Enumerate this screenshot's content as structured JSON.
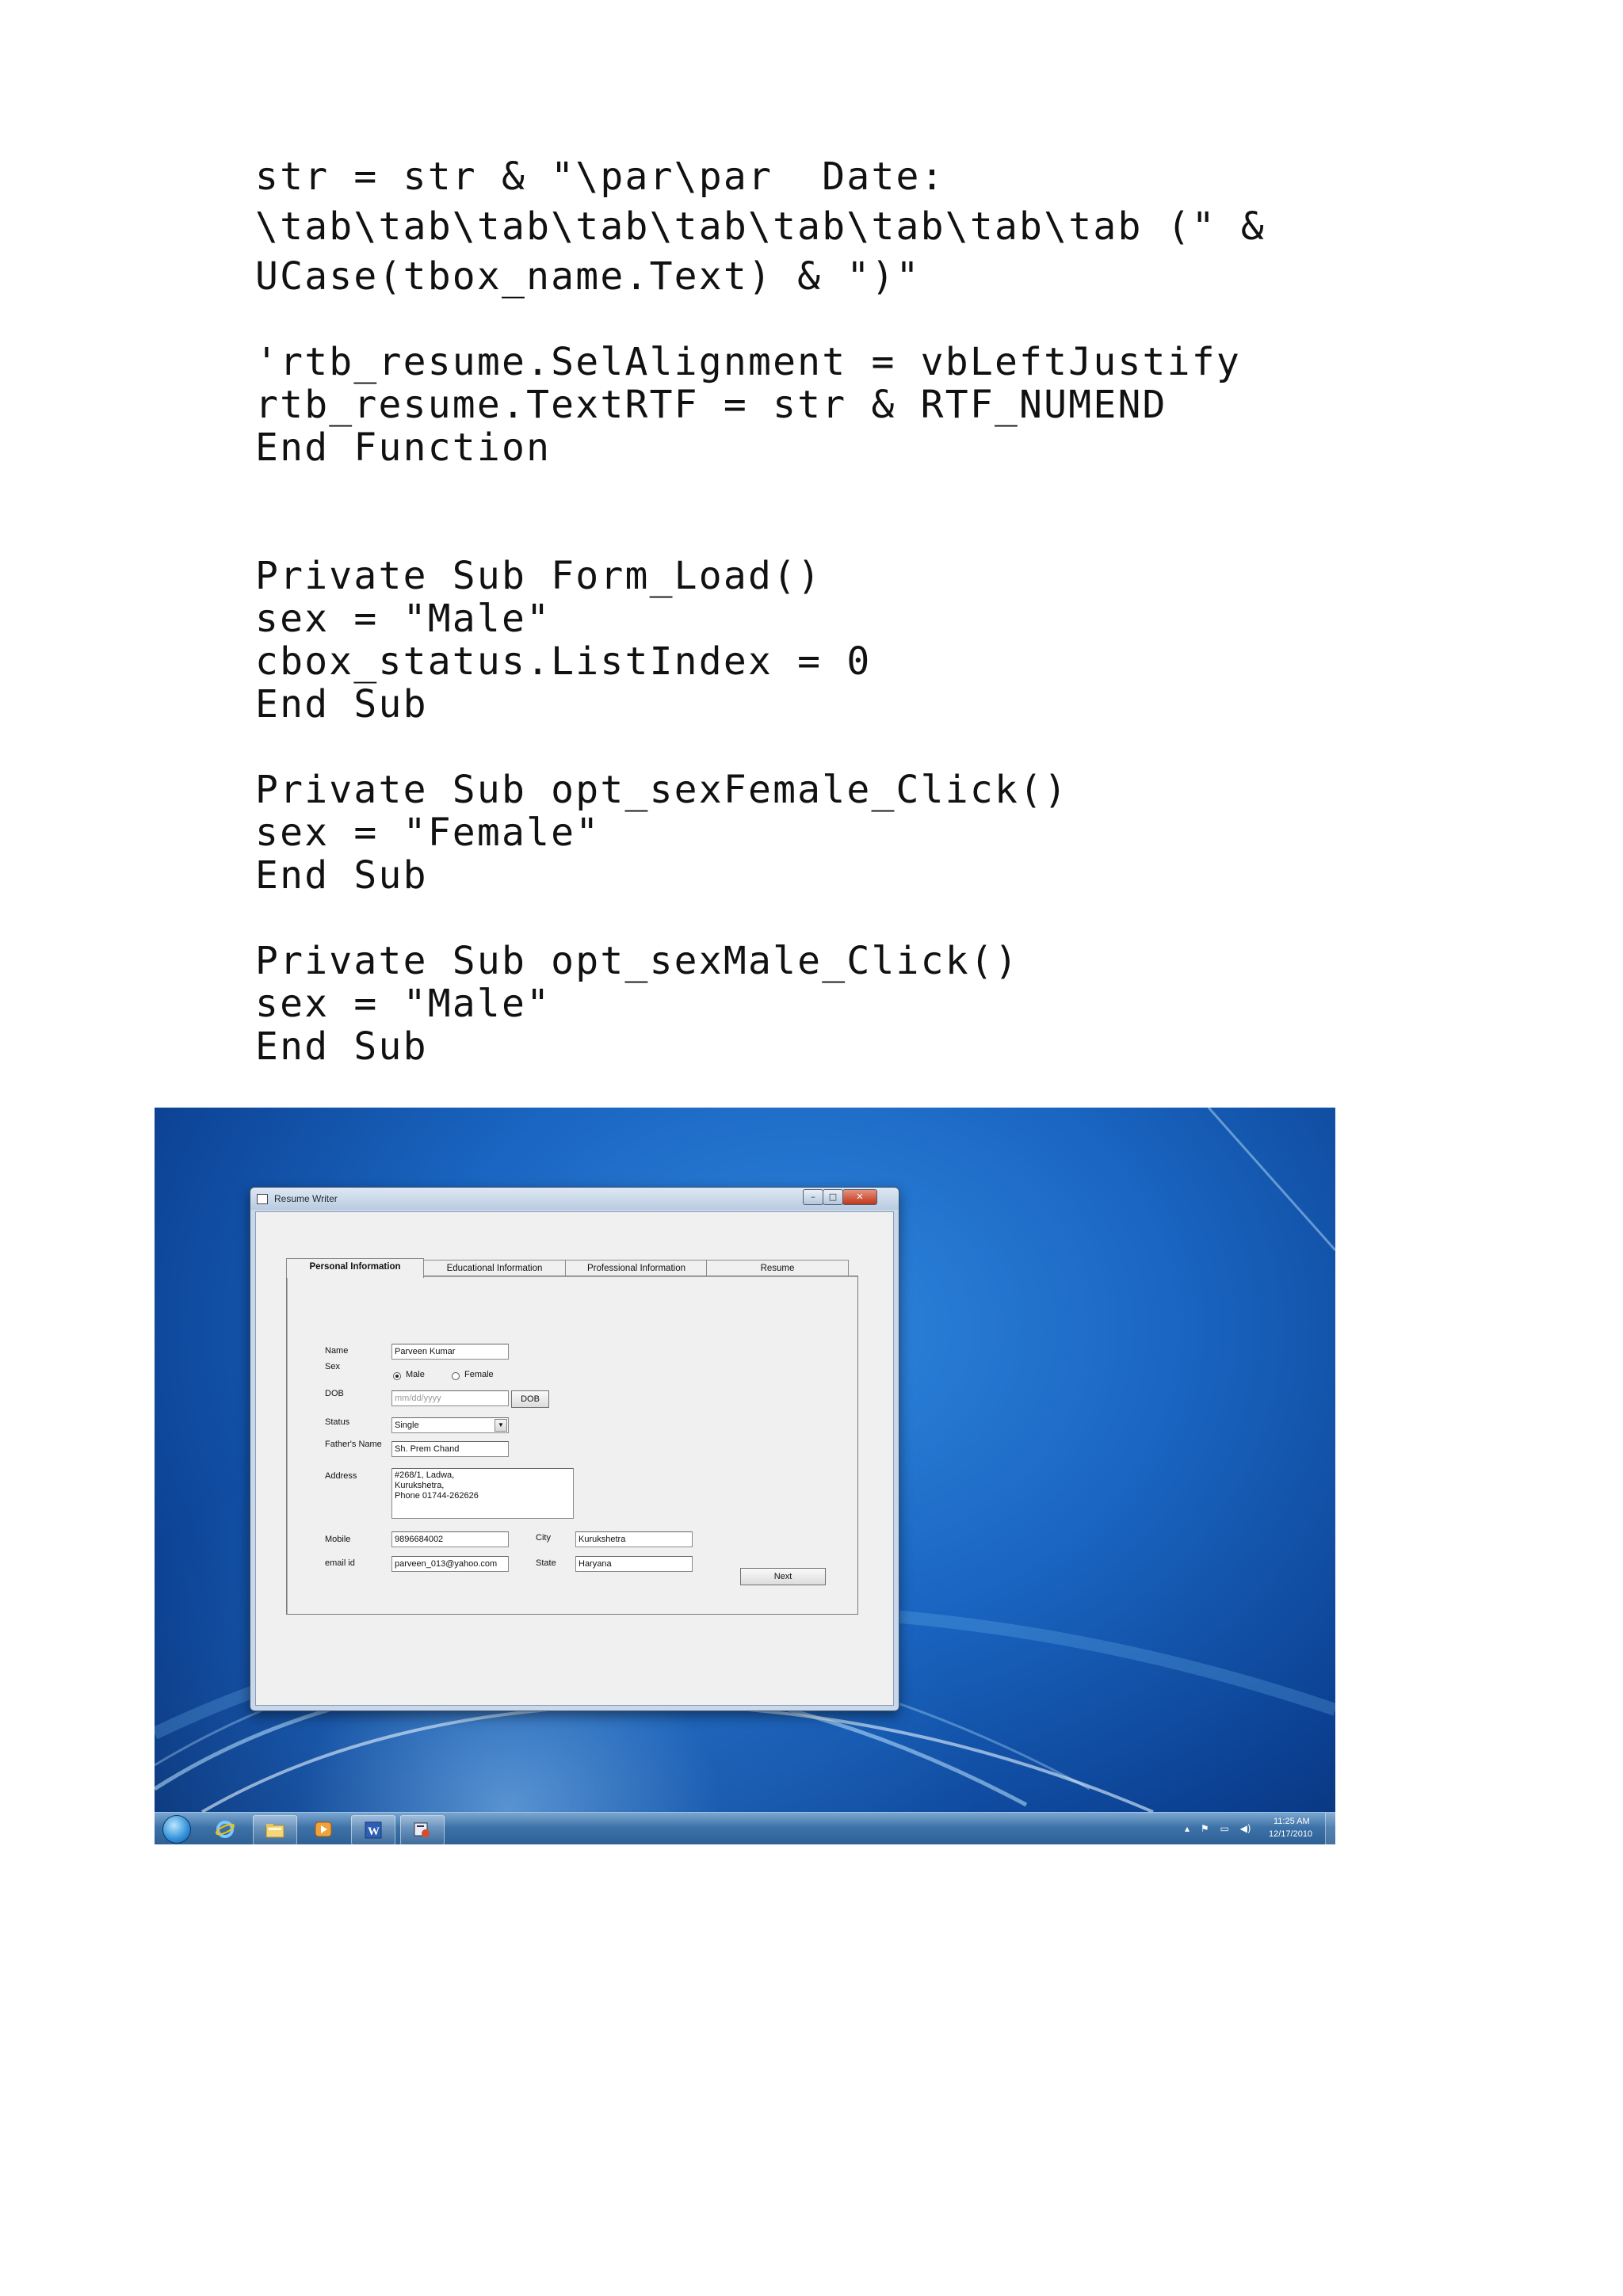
{
  "code_block_1": [
    "str = str & \"\\par\\par  Date:",
    "\\tab\\tab\\tab\\tab\\tab\\tab\\tab\\tab\\tab (\" &",
    "UCase(tbox_name.Text) & \")\""
  ],
  "code_block_2": [
    "'rtb_resume.SelAlignment = vbLeftJustify",
    "rtb_resume.TextRTF = str & RTF_NUMEND",
    "End Function",
    "",
    "",
    "Private Sub Form_Load()",
    "sex = \"Male\"",
    "cbox_status.ListIndex = 0",
    "End Sub",
    "",
    "Private Sub opt_sexFemale_Click()",
    "sex = \"Female\"",
    "End Sub",
    "",
    "Private Sub opt_sexMale_Click()",
    "sex = \"Male\"",
    "End Sub"
  ],
  "window": {
    "title": "Resume Writer",
    "tabs": [
      "Personal Information",
      "Educational Information",
      "Professional Information",
      "Resume"
    ],
    "active_tab": "Personal Information"
  },
  "form": {
    "name_label": "Name",
    "name_value": "Parveen Kumar",
    "sex_label": "Sex",
    "sex_options": [
      "Male",
      "Female"
    ],
    "sex_selected": "Male",
    "dob_label": "DOB",
    "dob_placeholder": "mm/dd/yyyy",
    "dob_button": "DOB",
    "status_label": "Status",
    "status_value": "Single",
    "father_label": "Father's Name",
    "father_value": "Sh. Prem Chand",
    "address_label": "Address",
    "address_value": "#268/1, Ladwa,\nKurukshetra,\nPhone 01744-262626",
    "mobile_label": "Mobile",
    "mobile_value": "9896684002",
    "email_label": "email id",
    "email_value": "parveen_013@yahoo.com",
    "city_label": "City",
    "city_value": "Kurukshetra",
    "state_label": "State",
    "state_value": "Haryana",
    "next_button": "Next"
  },
  "taskbar": {
    "time": "11:25 AM",
    "date": "12/17/2010",
    "icons": [
      "start-orb",
      "internet-explorer",
      "windows-explorer",
      "media-player",
      "microsoft-word",
      "resume-writer-app"
    ]
  }
}
